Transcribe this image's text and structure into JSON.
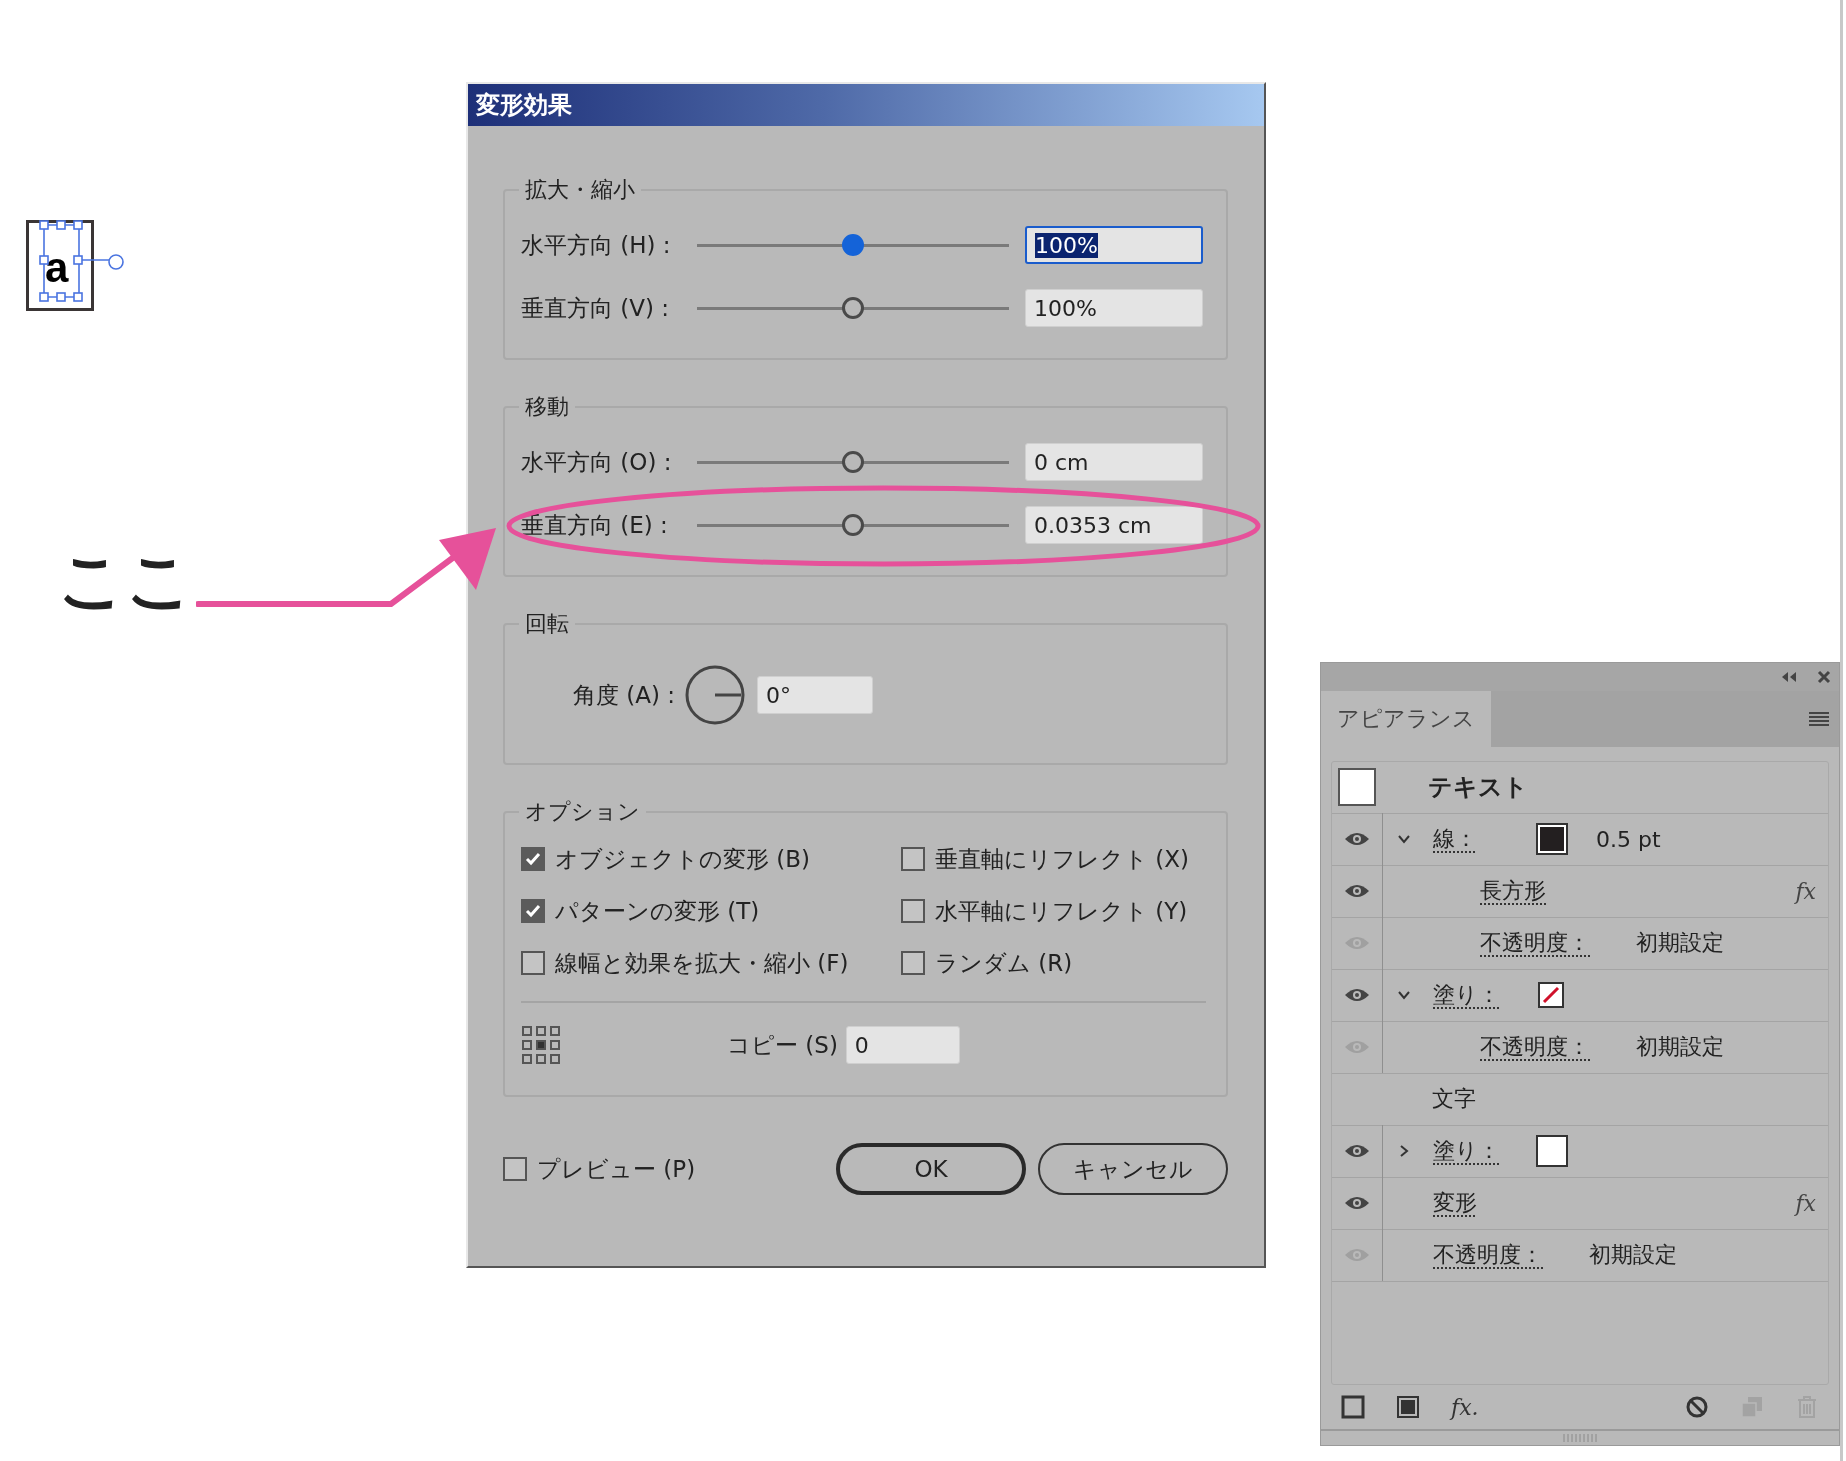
{
  "canvas": {
    "text": "a"
  },
  "annotation": {
    "label": "ここ"
  },
  "dialog": {
    "title": "変形効果",
    "scale": {
      "title": "拡大・縮小",
      "rows": [
        {
          "label": "水平方向 (H) :",
          "level": 0.5,
          "value": "100%",
          "focused": true,
          "highlighted": false
        },
        {
          "label": "垂直方向 (V) :",
          "level": 0.5,
          "value": "100%",
          "focused": false,
          "highlighted": false
        }
      ]
    },
    "move": {
      "title": "移動",
      "rows": [
        {
          "label": "水平方向 (O) :",
          "level": 0.5,
          "value": "0 cm",
          "focused": false,
          "highlighted": false
        },
        {
          "label": "垂直方向 (E) :",
          "level": 0.5,
          "value": "0.0353 cm",
          "focused": false,
          "highlighted": true
        }
      ]
    },
    "rotate": {
      "title": "回転",
      "label": "角度 (A) :",
      "value": "0°"
    },
    "options": {
      "title": "オプション",
      "checkboxes": [
        {
          "label": "オブジェクトの変形 (B)",
          "checked": true
        },
        {
          "label": "垂直軸にリフレクト (X)",
          "checked": false
        },
        {
          "label": "パターンの変形 (T)",
          "checked": true
        },
        {
          "label": "水平軸にリフレクト (Y)",
          "checked": false
        },
        {
          "label": "線幅と効果を拡大・縮小 (F)",
          "checked": false
        },
        {
          "label": "ランダム (R)",
          "checked": false
        }
      ],
      "copy": {
        "label": "コピー (S)",
        "value": "0"
      }
    },
    "preview": {
      "label": "プレビュー (P)",
      "checked": false
    },
    "buttons": [
      {
        "label": "OK",
        "default": true
      },
      {
        "label": "キャンセル",
        "default": false
      }
    ]
  },
  "panel": {
    "tab": {
      "label": "アピアランス",
      "selected": true
    },
    "target": {
      "label": "テキスト"
    },
    "items": [
      {
        "kind": "attribute",
        "label": "線：",
        "eye_enabled": true,
        "expanded": true,
        "swatch": {
          "kind": "solid",
          "color": "#231f20"
        },
        "value": "0.5 pt",
        "children": [
          {
            "kind": "effect",
            "label": "長方形",
            "eye_enabled": true,
            "fx": "fx"
          },
          {
            "kind": "opacity",
            "label": "不透明度：",
            "eye_enabled": false,
            "value": "初期設定"
          }
        ]
      },
      {
        "kind": "attribute",
        "label": "塗り：",
        "eye_enabled": true,
        "expanded": true,
        "swatch": {
          "kind": "none"
        },
        "children": [
          {
            "kind": "opacity",
            "label": "不透明度：",
            "eye_enabled": false,
            "value": "初期設定"
          }
        ]
      },
      {
        "kind": "heading",
        "label": "文字"
      },
      {
        "kind": "attribute",
        "label": "塗り：",
        "eye_enabled": true,
        "expanded": false,
        "swatch": {
          "kind": "solid",
          "color": "#ffffff"
        }
      },
      {
        "kind": "effect",
        "label": "変形",
        "eye_enabled": true,
        "fx": "fx"
      },
      {
        "kind": "opacity",
        "label": "不透明度：",
        "eye_enabled": false,
        "value": "初期設定"
      }
    ],
    "toolbar": [
      {
        "kind": "stroke",
        "disabled": false
      },
      {
        "kind": "fill",
        "disabled": false
      },
      {
        "kind": "fx",
        "label": "fx.",
        "disabled": false
      },
      {
        "kind": "clear",
        "disabled": false
      },
      {
        "kind": "duplicate",
        "disabled": true
      },
      {
        "kind": "delete",
        "disabled": true
      }
    ]
  }
}
